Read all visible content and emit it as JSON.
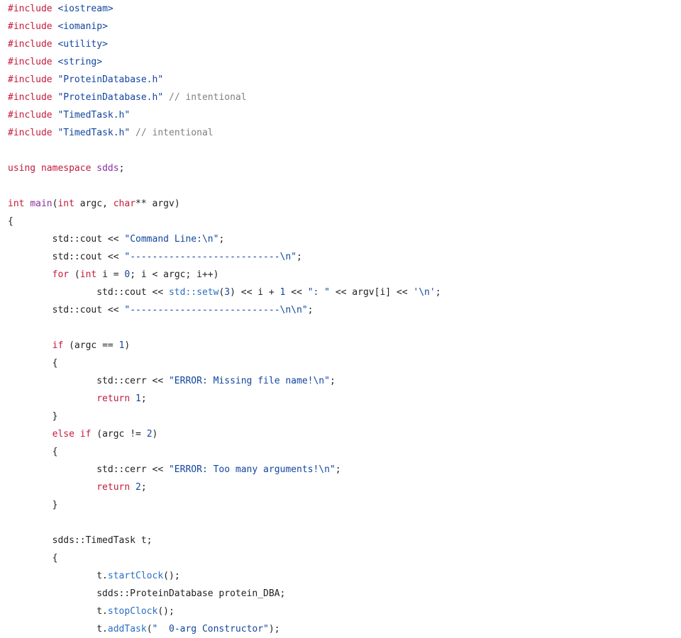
{
  "editor": {
    "language": "C++",
    "background_color": "#ffffff",
    "colors": {
      "preprocessor": "#c41a3b",
      "keyword": "#c41a3b",
      "namespace": "#8b2fa0",
      "string": "#12459e",
      "number": "#12459e",
      "function": "#2a6fc4",
      "comment": "#808080",
      "plain": "#222222"
    }
  },
  "code": {
    "lines": [
      {
        "n": 1,
        "tokens": [
          {
            "t": "pre",
            "v": "#include"
          },
          {
            "t": "txt",
            "v": " "
          },
          {
            "t": "str",
            "v": "<iostream>"
          }
        ]
      },
      {
        "n": 2,
        "tokens": [
          {
            "t": "pre",
            "v": "#include"
          },
          {
            "t": "txt",
            "v": " "
          },
          {
            "t": "str",
            "v": "<iomanip>"
          }
        ]
      },
      {
        "n": 3,
        "tokens": [
          {
            "t": "pre",
            "v": "#include"
          },
          {
            "t": "txt",
            "v": " "
          },
          {
            "t": "str",
            "v": "<utility>"
          }
        ]
      },
      {
        "n": 4,
        "tokens": [
          {
            "t": "pre",
            "v": "#include"
          },
          {
            "t": "txt",
            "v": " "
          },
          {
            "t": "str",
            "v": "<string>"
          }
        ]
      },
      {
        "n": 5,
        "tokens": [
          {
            "t": "pre",
            "v": "#include"
          },
          {
            "t": "txt",
            "v": " "
          },
          {
            "t": "str",
            "v": "\"ProteinDatabase.h\""
          }
        ]
      },
      {
        "n": 6,
        "tokens": [
          {
            "t": "pre",
            "v": "#include"
          },
          {
            "t": "txt",
            "v": " "
          },
          {
            "t": "str",
            "v": "\"ProteinDatabase.h\""
          },
          {
            "t": "txt",
            "v": " "
          },
          {
            "t": "cmt",
            "v": "// intentional"
          }
        ]
      },
      {
        "n": 7,
        "tokens": [
          {
            "t": "pre",
            "v": "#include"
          },
          {
            "t": "txt",
            "v": " "
          },
          {
            "t": "str",
            "v": "\"TimedTask.h\""
          }
        ]
      },
      {
        "n": 8,
        "tokens": [
          {
            "t": "pre",
            "v": "#include"
          },
          {
            "t": "txt",
            "v": " "
          },
          {
            "t": "str",
            "v": "\"TimedTask.h\""
          },
          {
            "t": "txt",
            "v": " "
          },
          {
            "t": "cmt",
            "v": "// intentional"
          }
        ]
      },
      {
        "n": 9,
        "tokens": []
      },
      {
        "n": 10,
        "tokens": [
          {
            "t": "kw",
            "v": "using"
          },
          {
            "t": "txt",
            "v": " "
          },
          {
            "t": "kw",
            "v": "namespace"
          },
          {
            "t": "txt",
            "v": " "
          },
          {
            "t": "ns",
            "v": "sdds"
          },
          {
            "t": "txt",
            "v": ";"
          }
        ]
      },
      {
        "n": 11,
        "tokens": []
      },
      {
        "n": 12,
        "tokens": [
          {
            "t": "kw",
            "v": "int"
          },
          {
            "t": "txt",
            "v": " "
          },
          {
            "t": "ns",
            "v": "main"
          },
          {
            "t": "txt",
            "v": "("
          },
          {
            "t": "kw",
            "v": "int"
          },
          {
            "t": "txt",
            "v": " argc, "
          },
          {
            "t": "kw",
            "v": "char"
          },
          {
            "t": "txt",
            "v": "** argv)"
          }
        ]
      },
      {
        "n": 13,
        "tokens": [
          {
            "t": "txt",
            "v": "{"
          }
        ]
      },
      {
        "n": 14,
        "tokens": [
          {
            "t": "txt",
            "v": "        std::cout << "
          },
          {
            "t": "str",
            "v": "\"Command Line:\\n\""
          },
          {
            "t": "txt",
            "v": ";"
          }
        ]
      },
      {
        "n": 15,
        "tokens": [
          {
            "t": "txt",
            "v": "        std::cout << "
          },
          {
            "t": "str",
            "v": "\"---------------------------\\n\""
          },
          {
            "t": "txt",
            "v": ";"
          }
        ]
      },
      {
        "n": 16,
        "tokens": [
          {
            "t": "txt",
            "v": "        "
          },
          {
            "t": "kw",
            "v": "for"
          },
          {
            "t": "txt",
            "v": " ("
          },
          {
            "t": "kw",
            "v": "int"
          },
          {
            "t": "txt",
            "v": " i = "
          },
          {
            "t": "num",
            "v": "0"
          },
          {
            "t": "txt",
            "v": "; i < argc; i++)"
          }
        ]
      },
      {
        "n": 17,
        "tokens": [
          {
            "t": "txt",
            "v": "                std::cout << "
          },
          {
            "t": "fn",
            "v": "std::setw"
          },
          {
            "t": "txt",
            "v": "("
          },
          {
            "t": "num",
            "v": "3"
          },
          {
            "t": "txt",
            "v": ") << i + "
          },
          {
            "t": "num",
            "v": "1"
          },
          {
            "t": "txt",
            "v": " << "
          },
          {
            "t": "str",
            "v": "\": \""
          },
          {
            "t": "txt",
            "v": " << argv[i] << "
          },
          {
            "t": "str",
            "v": "'\\n'"
          },
          {
            "t": "txt",
            "v": ";"
          }
        ]
      },
      {
        "n": 18,
        "tokens": [
          {
            "t": "txt",
            "v": "        std::cout << "
          },
          {
            "t": "str",
            "v": "\"---------------------------\\n\\n\""
          },
          {
            "t": "txt",
            "v": ";"
          }
        ]
      },
      {
        "n": 19,
        "tokens": []
      },
      {
        "n": 20,
        "tokens": [
          {
            "t": "txt",
            "v": "        "
          },
          {
            "t": "kw",
            "v": "if"
          },
          {
            "t": "txt",
            "v": " (argc == "
          },
          {
            "t": "num",
            "v": "1"
          },
          {
            "t": "txt",
            "v": ")"
          }
        ]
      },
      {
        "n": 21,
        "tokens": [
          {
            "t": "txt",
            "v": "        {"
          }
        ]
      },
      {
        "n": 22,
        "tokens": [
          {
            "t": "txt",
            "v": "                std::cerr << "
          },
          {
            "t": "str",
            "v": "\"ERROR: Missing file name!\\n\""
          },
          {
            "t": "txt",
            "v": ";"
          }
        ]
      },
      {
        "n": 23,
        "tokens": [
          {
            "t": "txt",
            "v": "                "
          },
          {
            "t": "kw",
            "v": "return"
          },
          {
            "t": "txt",
            "v": " "
          },
          {
            "t": "num",
            "v": "1"
          },
          {
            "t": "txt",
            "v": ";"
          }
        ]
      },
      {
        "n": 24,
        "tokens": [
          {
            "t": "txt",
            "v": "        }"
          }
        ]
      },
      {
        "n": 25,
        "tokens": [
          {
            "t": "txt",
            "v": "        "
          },
          {
            "t": "kw",
            "v": "else"
          },
          {
            "t": "txt",
            "v": " "
          },
          {
            "t": "kw",
            "v": "if"
          },
          {
            "t": "txt",
            "v": " (argc != "
          },
          {
            "t": "num",
            "v": "2"
          },
          {
            "t": "txt",
            "v": ")"
          }
        ]
      },
      {
        "n": 26,
        "tokens": [
          {
            "t": "txt",
            "v": "        {"
          }
        ]
      },
      {
        "n": 27,
        "tokens": [
          {
            "t": "txt",
            "v": "                std::cerr << "
          },
          {
            "t": "str",
            "v": "\"ERROR: Too many arguments!\\n\""
          },
          {
            "t": "txt",
            "v": ";"
          }
        ]
      },
      {
        "n": 28,
        "tokens": [
          {
            "t": "txt",
            "v": "                "
          },
          {
            "t": "kw",
            "v": "return"
          },
          {
            "t": "txt",
            "v": " "
          },
          {
            "t": "num",
            "v": "2"
          },
          {
            "t": "txt",
            "v": ";"
          }
        ]
      },
      {
        "n": 29,
        "tokens": [
          {
            "t": "txt",
            "v": "        }"
          }
        ]
      },
      {
        "n": 30,
        "tokens": []
      },
      {
        "n": 31,
        "tokens": [
          {
            "t": "txt",
            "v": "        sdds::TimedTask t;"
          }
        ]
      },
      {
        "n": 32,
        "tokens": [
          {
            "t": "txt",
            "v": "        {"
          }
        ]
      },
      {
        "n": 33,
        "tokens": [
          {
            "t": "txt",
            "v": "                t."
          },
          {
            "t": "fn",
            "v": "startClock"
          },
          {
            "t": "txt",
            "v": "();"
          }
        ]
      },
      {
        "n": 34,
        "tokens": [
          {
            "t": "txt",
            "v": "                sdds::ProteinDatabase protein_DBA;"
          }
        ]
      },
      {
        "n": 35,
        "tokens": [
          {
            "t": "txt",
            "v": "                t."
          },
          {
            "t": "fn",
            "v": "stopClock"
          },
          {
            "t": "txt",
            "v": "();"
          }
        ]
      },
      {
        "n": 36,
        "tokens": [
          {
            "t": "txt",
            "v": "                t."
          },
          {
            "t": "fn",
            "v": "addTask"
          },
          {
            "t": "txt",
            "v": "("
          },
          {
            "t": "str",
            "v": "\"  0-arg Constructor\""
          },
          {
            "t": "txt",
            "v": ");"
          }
        ]
      }
    ]
  }
}
